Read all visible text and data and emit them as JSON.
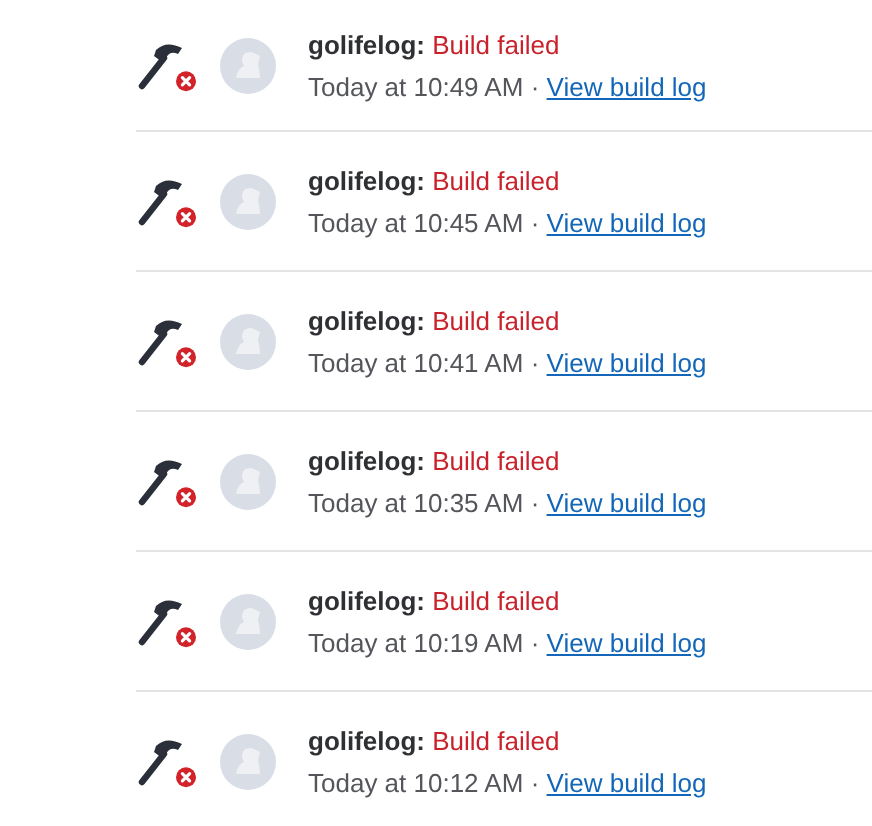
{
  "builds": [
    {
      "kind": "failed",
      "project": "golifelog:",
      "status": "Build failed",
      "time": "Today at 10:49 AM",
      "separator": "·",
      "link": "View build log"
    },
    {
      "kind": "failed",
      "project": "golifelog:",
      "status": "Build failed",
      "time": "Today at 10:45 AM",
      "separator": "·",
      "link": "View build log"
    },
    {
      "kind": "failed",
      "project": "golifelog:",
      "status": "Build failed",
      "time": "Today at 10:41 AM",
      "separator": "·",
      "link": "View build log"
    },
    {
      "kind": "failed",
      "project": "golifelog:",
      "status": "Build failed",
      "time": "Today at 10:35 AM",
      "separator": "·",
      "link": "View build log"
    },
    {
      "kind": "failed",
      "project": "golifelog:",
      "status": "Build failed",
      "time": "Today at 10:19 AM",
      "separator": "·",
      "link": "View build log"
    },
    {
      "kind": "failed",
      "project": "golifelog:",
      "status": "Build failed",
      "time": "Today at 10:12 AM",
      "separator": "·",
      "link": "View build log"
    }
  ]
}
